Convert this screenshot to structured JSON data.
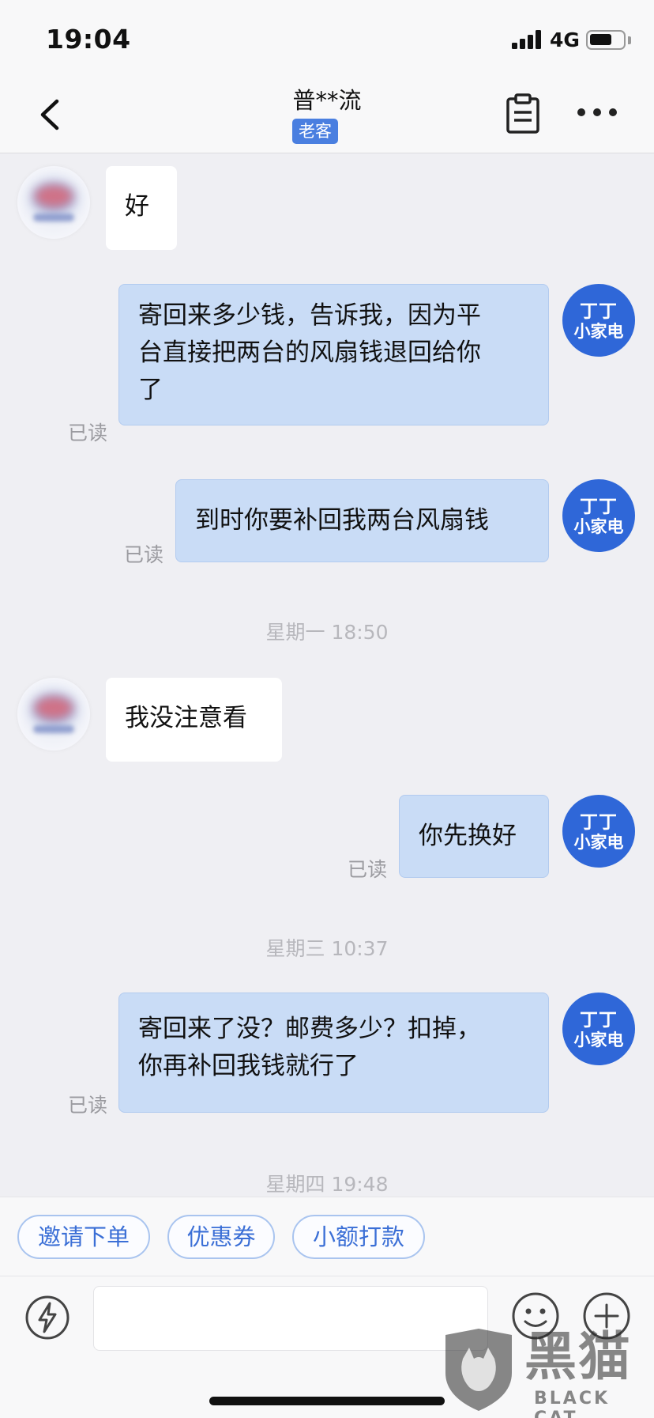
{
  "status_bar": {
    "time": "19:04",
    "network": "4G",
    "battery_level": 0.7
  },
  "nav": {
    "title": "普**流",
    "badge": "老客"
  },
  "messages": [
    {
      "side": "in",
      "text": "好"
    },
    {
      "side": "out",
      "lines": [
        "寄回来多少钱，告诉我，因为平",
        "台直接把两台的风扇钱退回给你",
        "了"
      ],
      "read": "已读"
    },
    {
      "side": "out",
      "text": "到时你要补回我两台风扇钱",
      "read": "已读"
    },
    {
      "side": "time",
      "text": "星期一 18:50"
    },
    {
      "side": "in",
      "text": "我没注意看"
    },
    {
      "side": "out",
      "text": "你先换好",
      "read": "已读"
    },
    {
      "side": "time",
      "text": "星期三 10:37"
    },
    {
      "side": "out",
      "lines": [
        "寄回来了没？邮费多少？扣掉，",
        "你再补回我钱就行了"
      ],
      "read": "已读"
    },
    {
      "side": "time",
      "text": "星期四 19:48"
    }
  ],
  "my_avatar": {
    "line1": "丁丁",
    "line2": "小家电",
    "color": "#2f67d8"
  },
  "quick_replies": [
    "邀请下单",
    "优惠券",
    "小额打款"
  ],
  "input": {
    "placeholder": ""
  },
  "icons": [
    "back-icon",
    "notes-icon",
    "more-icon",
    "flash-icon",
    "emoji-icon",
    "plus-icon"
  ],
  "watermark": {
    "chinese": "黑猫",
    "english": "BLACK CAT"
  },
  "colors": {
    "accent": "#4a7fe0",
    "outgoing_bubble": "#c9dcf6",
    "avatar": "#2f67d8"
  }
}
